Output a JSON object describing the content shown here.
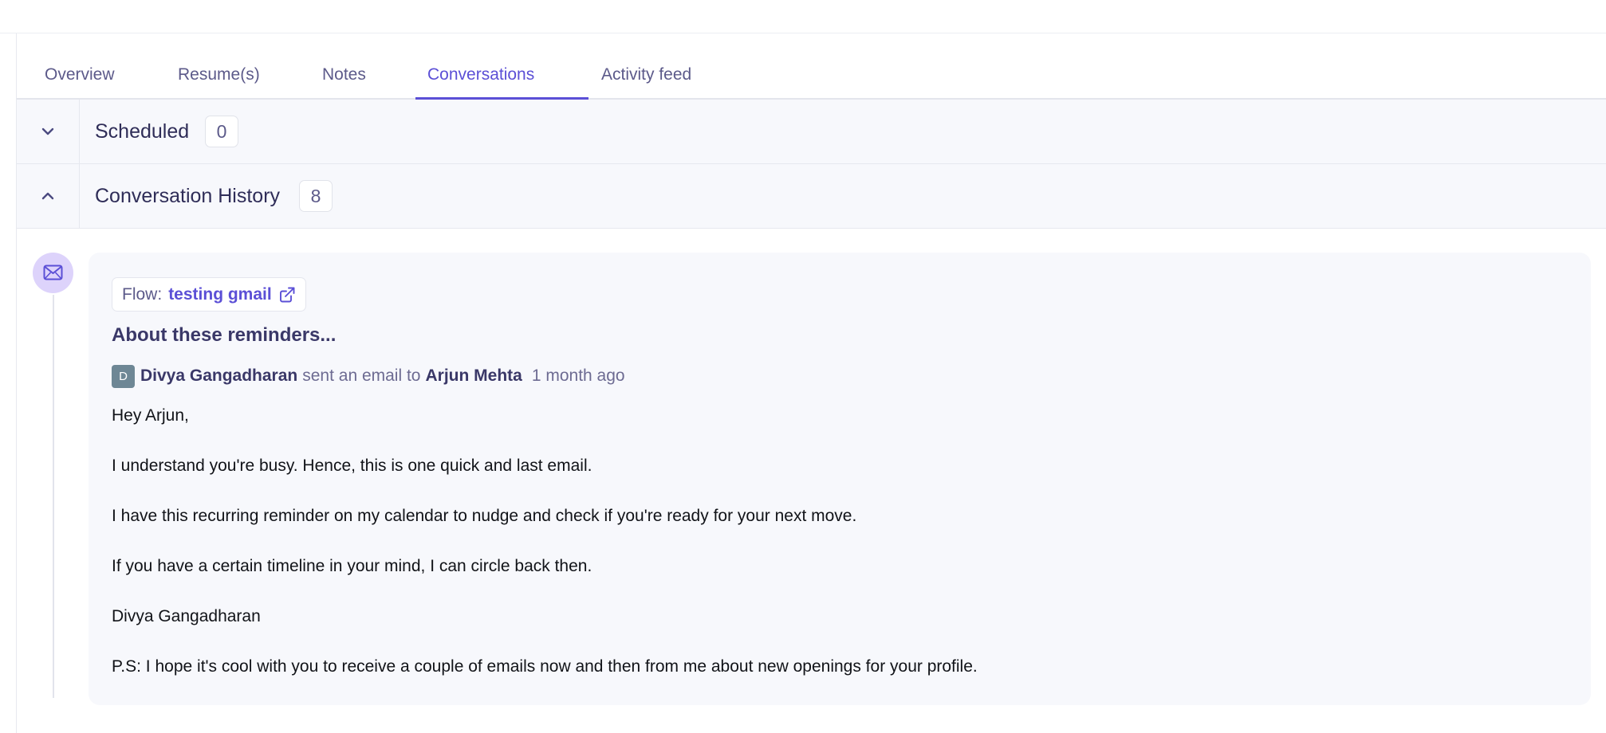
{
  "tabs": [
    {
      "label": "Overview"
    },
    {
      "label": "Resume(s)"
    },
    {
      "label": "Notes"
    },
    {
      "label": "Conversations"
    },
    {
      "label": "Activity feed"
    }
  ],
  "active_tab": "Conversations",
  "sections": {
    "scheduled": {
      "title": "Scheduled",
      "count": "0",
      "state": "collapsed"
    },
    "history": {
      "title": "Conversation History",
      "count": "8",
      "state": "expanded"
    }
  },
  "message": {
    "icon": "mail-icon",
    "flow_label": "Flow:",
    "flow_name": "testing gmail",
    "subject": "About these reminders...",
    "avatar_initial": "D",
    "sender": "Divya Gangadharan",
    "action": "sent an email to",
    "recipient": "Arjun Mehta",
    "time_ago": "1 month ago",
    "body": [
      "Hey Arjun,",
      "I understand you're busy. Hence, this is one quick and last email.",
      "I have this recurring reminder on my calendar to nudge and check if you're ready for your next move.",
      "If you have a certain timeline in your mind, I can circle back then.",
      "Divya Gangadharan",
      "P.S: I hope it's cool with you to receive a couple of emails now and then from me about new openings for your profile."
    ]
  },
  "colors": {
    "accent": "#5b4fd6",
    "muted_text": "#5c5a8a",
    "panel_bg": "#f7f8fc",
    "mail_circle": "#ddd3fb",
    "avatar_bg": "#6e8795"
  }
}
